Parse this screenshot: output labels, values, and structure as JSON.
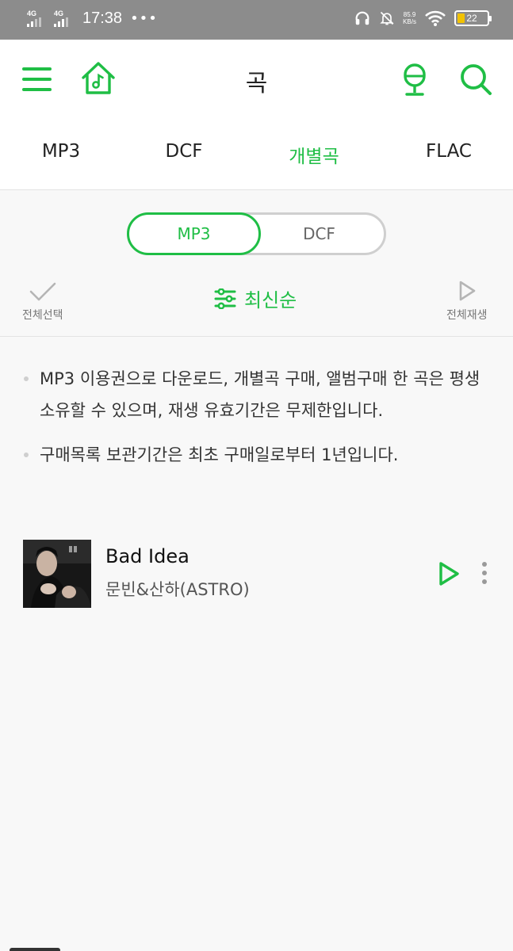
{
  "status_bar": {
    "network1": "4G",
    "network2": "4G",
    "time": "17:38",
    "more": "•••",
    "speed_value": "85.9",
    "speed_unit": "KB/s",
    "battery_level": "22",
    "battery_color": "#f2c200"
  },
  "header": {
    "title": "곡",
    "icons": [
      "menu-icon",
      "home-music-icon",
      "mic-icon",
      "search-icon"
    ],
    "accent_color": "#1fbe45"
  },
  "tabs": [
    {
      "label": "MP3",
      "active": false
    },
    {
      "label": "DCF",
      "active": false
    },
    {
      "label": "개별곡",
      "active": true
    },
    {
      "label": "FLAC",
      "active": false
    }
  ],
  "segment": {
    "options": [
      "MP3",
      "DCF"
    ],
    "selected": "MP3"
  },
  "toolbar": {
    "select_all": "전체선택",
    "sort": "최신순",
    "play_all": "전체재생"
  },
  "notices": [
    "MP3 이용권으로 다운로드, 개별곡 구매, 앨범구매 한 곡은 평생 소유할 수 있으며, 재생 유효기간은 무제한입니다.",
    "구매목록 보관기간은 최초 구매일로부터 1년입니다."
  ],
  "songs": [
    {
      "title": "Bad Idea",
      "artist": "문빈&산하(ASTRO)"
    }
  ]
}
